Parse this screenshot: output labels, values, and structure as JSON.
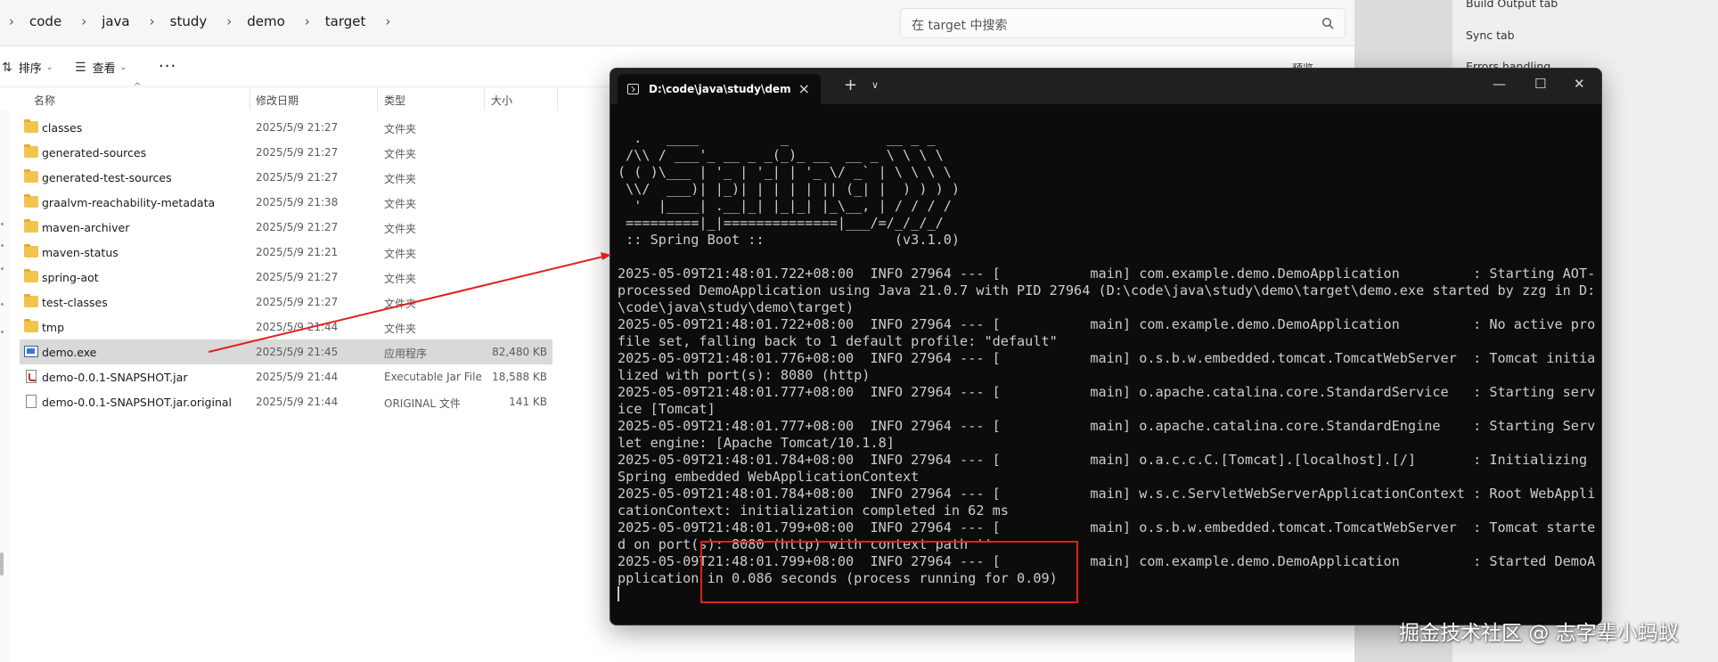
{
  "explorer": {
    "breadcrumbs": [
      "code",
      "java",
      "study",
      "demo",
      "target"
    ],
    "search_placeholder": "在 target 中搜索",
    "toolbar": {
      "sort_label": "排序",
      "view_label": "查看",
      "more_label": "···",
      "preview_label": "预览"
    },
    "columns": {
      "name": "名称",
      "date": "修改日期",
      "type": "类型",
      "size": "大小"
    },
    "files": [
      {
        "name": "classes",
        "date": "2025/5/9 21:27",
        "type": "文件夹",
        "size": "",
        "icon": "folder-icon"
      },
      {
        "name": "generated-sources",
        "date": "2025/5/9 21:27",
        "type": "文件夹",
        "size": "",
        "icon": "folder-icon"
      },
      {
        "name": "generated-test-sources",
        "date": "2025/5/9 21:27",
        "type": "文件夹",
        "size": "",
        "icon": "folder-icon"
      },
      {
        "name": "graalvm-reachability-metadata",
        "date": "2025/5/9 21:38",
        "type": "文件夹",
        "size": "",
        "icon": "folder-icon"
      },
      {
        "name": "maven-archiver",
        "date": "2025/5/9 21:27",
        "type": "文件夹",
        "size": "",
        "icon": "folder-icon"
      },
      {
        "name": "maven-status",
        "date": "2025/5/9 21:21",
        "type": "文件夹",
        "size": "",
        "icon": "folder-icon"
      },
      {
        "name": "spring-aot",
        "date": "2025/5/9 21:27",
        "type": "文件夹",
        "size": "",
        "icon": "folder-icon"
      },
      {
        "name": "test-classes",
        "date": "2025/5/9 21:27",
        "type": "文件夹",
        "size": "",
        "icon": "folder-icon"
      },
      {
        "name": "tmp",
        "date": "2025/5/9 21:44",
        "type": "文件夹",
        "size": "",
        "icon": "folder-icon"
      },
      {
        "name": "demo.exe",
        "date": "2025/5/9 21:45",
        "type": "应用程序",
        "size": "82,480 KB",
        "icon": "exe-icon",
        "selected": true
      },
      {
        "name": "demo-0.0.1-SNAPSHOT.jar",
        "date": "2025/5/9 21:44",
        "type": "Executable Jar File",
        "size": "18,588 KB",
        "icon": "jar-icon"
      },
      {
        "name": "demo-0.0.1-SNAPSHOT.jar.original",
        "date": "2025/5/9 21:44",
        "type": "ORIGINAL 文件",
        "size": "141 KB",
        "icon": "file-icon"
      }
    ]
  },
  "sidepanel": {
    "items": [
      "Build Output tab",
      "Sync tab",
      "Errors handling"
    ]
  },
  "terminal": {
    "tab_title": "D:\\code\\java\\study\\demo\\tar",
    "new_tab_label": "+",
    "dropdown_label": "⌄",
    "lines": [
      "",
      "  .   ____          _            __ _ _",
      " /\\\\ / ___'_ __ _ _(_)_ __  __ _ \\ \\ \\ \\",
      "( ( )\\___ | '_ | '_| | '_ \\/ _` | \\ \\ \\ \\",
      " \\\\/  ___)| |_)| | | | | || (_| |  ) ) ) )",
      "  '  |____| .__|_| |_|_| |_\\__, | / / / /",
      " =========|_|==============|___/=/_/_/_/",
      " :: Spring Boot ::                (v3.1.0)",
      "",
      "2025-05-09T21:48:01.722+08:00  INFO 27964 --- [           main] com.example.demo.DemoApplication         : Starting AOT-",
      "processed DemoApplication using Java 21.0.7 with PID 27964 (D:\\code\\java\\study\\demo\\target\\demo.exe started by zzg in D:",
      "\\code\\java\\study\\demo\\target)",
      "2025-05-09T21:48:01.722+08:00  INFO 27964 --- [           main] com.example.demo.DemoApplication         : No active pro",
      "file set, falling back to 1 default profile: \"default\"",
      "2025-05-09T21:48:01.776+08:00  INFO 27964 --- [           main] o.s.b.w.embedded.tomcat.TomcatWebServer  : Tomcat initia",
      "lized with port(s): 8080 (http)",
      "2025-05-09T21:48:01.777+08:00  INFO 27964 --- [           main] o.apache.catalina.core.StandardService   : Starting serv",
      "ice [Tomcat]",
      "2025-05-09T21:48:01.777+08:00  INFO 27964 --- [           main] o.apache.catalina.core.StandardEngine    : Starting Serv",
      "let engine: [Apache Tomcat/10.1.8]",
      "2025-05-09T21:48:01.784+08:00  INFO 27964 --- [           main] o.a.c.c.C.[Tomcat].[localhost].[/]       : Initializing",
      "Spring embedded WebApplicationContext",
      "2025-05-09T21:48:01.784+08:00  INFO 27964 --- [           main] w.s.c.ServletWebServerApplicationContext : Root WebAppli",
      "cationContext: initialization completed in 62 ms",
      "2025-05-09T21:48:01.799+08:00  INFO 27964 --- [           main] o.s.b.w.embedded.tomcat.TomcatWebServer  : Tomcat starte",
      "d on port(s): 8080 (http) with context path ''",
      "2025-05-09T21:48:01.799+08:00  INFO 27964 --- [           main] com.example.demo.DemoApplication         : Started DemoA",
      "pplication in 0.086 seconds (process running for 0.09)"
    ]
  },
  "watermark": "掘金技术社区 @ 志字辈小蚂蚁",
  "colors": {
    "annotation_red": "#e02020",
    "terminal_bg": "#0c0c0c",
    "folder_yellow": "#f2c44d"
  }
}
